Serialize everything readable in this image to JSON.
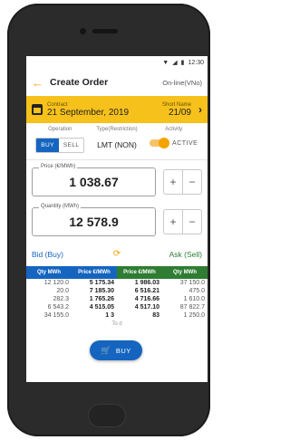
{
  "status": {
    "signal": "▼",
    "wifi": "◢",
    "battery": "▮",
    "time": "12:30"
  },
  "appbar": {
    "back_icon": "←",
    "title": "Create Order",
    "online": "On-line(VNo)"
  },
  "contract": {
    "label": "Contract",
    "date": "21 September, 2019",
    "short_label": "Short Name",
    "short_value": "21/09",
    "chevron": "›"
  },
  "operation": {
    "caption": "Operation",
    "buy": "BUY",
    "sell": "SELL",
    "type_caption": "Type(Restriction)",
    "type_value": "LMT (NON)",
    "activity_caption": "Activity",
    "activity_value": "ACTIVE"
  },
  "price": {
    "label": "Price (€/MWh)",
    "value": "1 038.67"
  },
  "quantity": {
    "label": "Quantity (MWh)",
    "value": "12 578.9"
  },
  "stepper": {
    "plus": "+",
    "minus": "−"
  },
  "bidask": {
    "bid": "Bid (Buy)",
    "ask": "Ask (Sell)",
    "sync_icon": "⟳"
  },
  "book": {
    "headers": [
      "Qty MWh",
      "Price €/MWh",
      "Price €/MWh",
      "Qty MWh"
    ],
    "rows": [
      {
        "bq": "12 120.0",
        "bp": "5 175.34",
        "ap": "1 986.03",
        "aq": "37 150.0"
      },
      {
        "bq": "20.0",
        "bp": "7 185.30",
        "ap": "6 516.21",
        "aq": "475.0"
      },
      {
        "bq": "282.3",
        "bp": "1 765.26",
        "ap": "4 716.66",
        "aq": "1 610.0"
      },
      {
        "bq": "6 543.2",
        "bp": "4 515.05",
        "ap": "4 517.10",
        "aq": "87 822.7"
      },
      {
        "bq": "34 155.0",
        "bp": "1 3",
        "ap": "83",
        "aq": "1 250.0"
      }
    ],
    "footer": "To          d"
  },
  "fab": {
    "cart_icon": "🛒",
    "label": "BUY"
  },
  "colors": {
    "accent": "#f5a300",
    "bid_blue": "#1565c0",
    "ask_green": "#2e7d32",
    "contract_bar": "#f7c11c"
  }
}
